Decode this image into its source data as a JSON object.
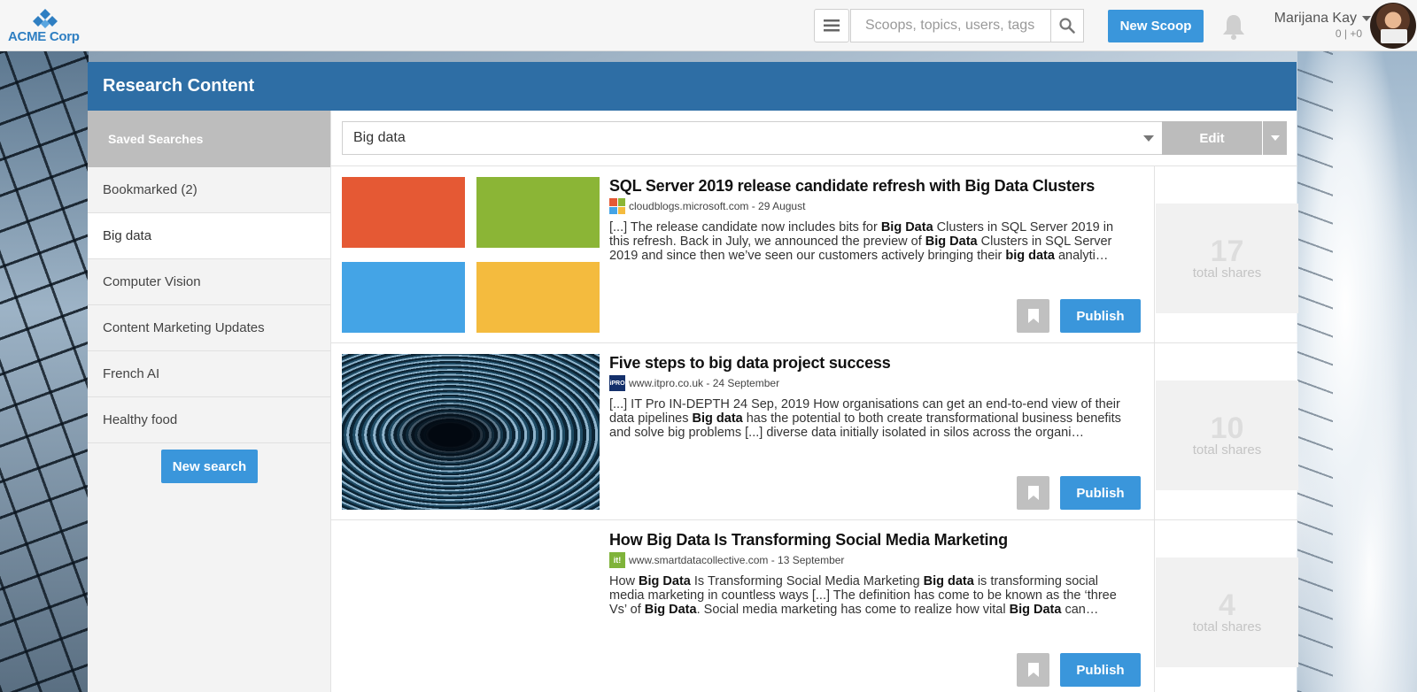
{
  "brand": {
    "name": "ACME Corp",
    "color": "#2f7fc2"
  },
  "topbar": {
    "search_placeholder": "Scoops, topics, users, tags",
    "new_scoop_label": "New Scoop",
    "user_name": "Marijana Kay",
    "user_score": "0 | +0"
  },
  "panel": {
    "title": "Research Content"
  },
  "sidebar": {
    "heading": "Saved Searches",
    "items": [
      {
        "label": "Bookmarked (2)"
      },
      {
        "label": "Big data",
        "active": true
      },
      {
        "label": "Computer Vision"
      },
      {
        "label": "Content Marketing Updates"
      },
      {
        "label": "French AI"
      },
      {
        "label": "Healthy food"
      }
    ],
    "new_search_label": "New search"
  },
  "filter": {
    "selected": "Big data",
    "edit_label": "Edit"
  },
  "articles": [
    {
      "title": "SQL Server 2019 release candidate refresh with Big Data Clusters",
      "source": "cloudblogs.microsoft.com - 29 August",
      "favicon": "microsoft-icon",
      "excerpt_html": "[...] The release candidate now includes bits for <b>Big Data</b> Clusters in SQL Server 2019 in this refresh. Back in July, we announced the preview of <b>Big Data</b> Clusters in SQL Server 2019 and since then we’ve seen our customers actively bringing their <b>big data</b> analyti…",
      "shares": "17",
      "shares_label": "total shares",
      "publish_label": "Publish"
    },
    {
      "title": "Five steps to big data project success",
      "source": "www.itpro.co.uk - 24 September",
      "favicon": "itpro-icon",
      "favicon_text": "iPRO",
      "excerpt_html": "[...] IT Pro IN-DEPTH 24 Sep, 2019 How organisations can get an end-to-end view of their data pipelines <b>Big data</b> has the potential to both create transformational business benefits and solve big problems [...] diverse data initially isolated in silos across the organi…",
      "shares": "10",
      "shares_label": "total shares",
      "publish_label": "Publish"
    },
    {
      "title": "How Big Data Is Transforming Social Media Marketing",
      "source": "www.smartdatacollective.com - 13 September",
      "favicon": "sdc-icon",
      "favicon_text": "it!",
      "excerpt_html": "How <b>Big Data</b> Is Transforming Social Media Marketing <b>Big data</b> is transforming social media marketing in countless ways [...] The definition has come to be known as the ‘three Vs’ of <b>Big Data</b>. Social media marketing has come to realize how vital <b>Big Data</b> can…",
      "shares": "4",
      "shares_label": "total shares",
      "publish_label": "Publish"
    }
  ],
  "colors": {
    "header_blue": "#2e6ea5",
    "button_blue": "#3a96db",
    "ms_red": "#e55934",
    "ms_green": "#8bb536",
    "ms_blue": "#44a4e6",
    "ms_yellow": "#f4bb3e"
  }
}
